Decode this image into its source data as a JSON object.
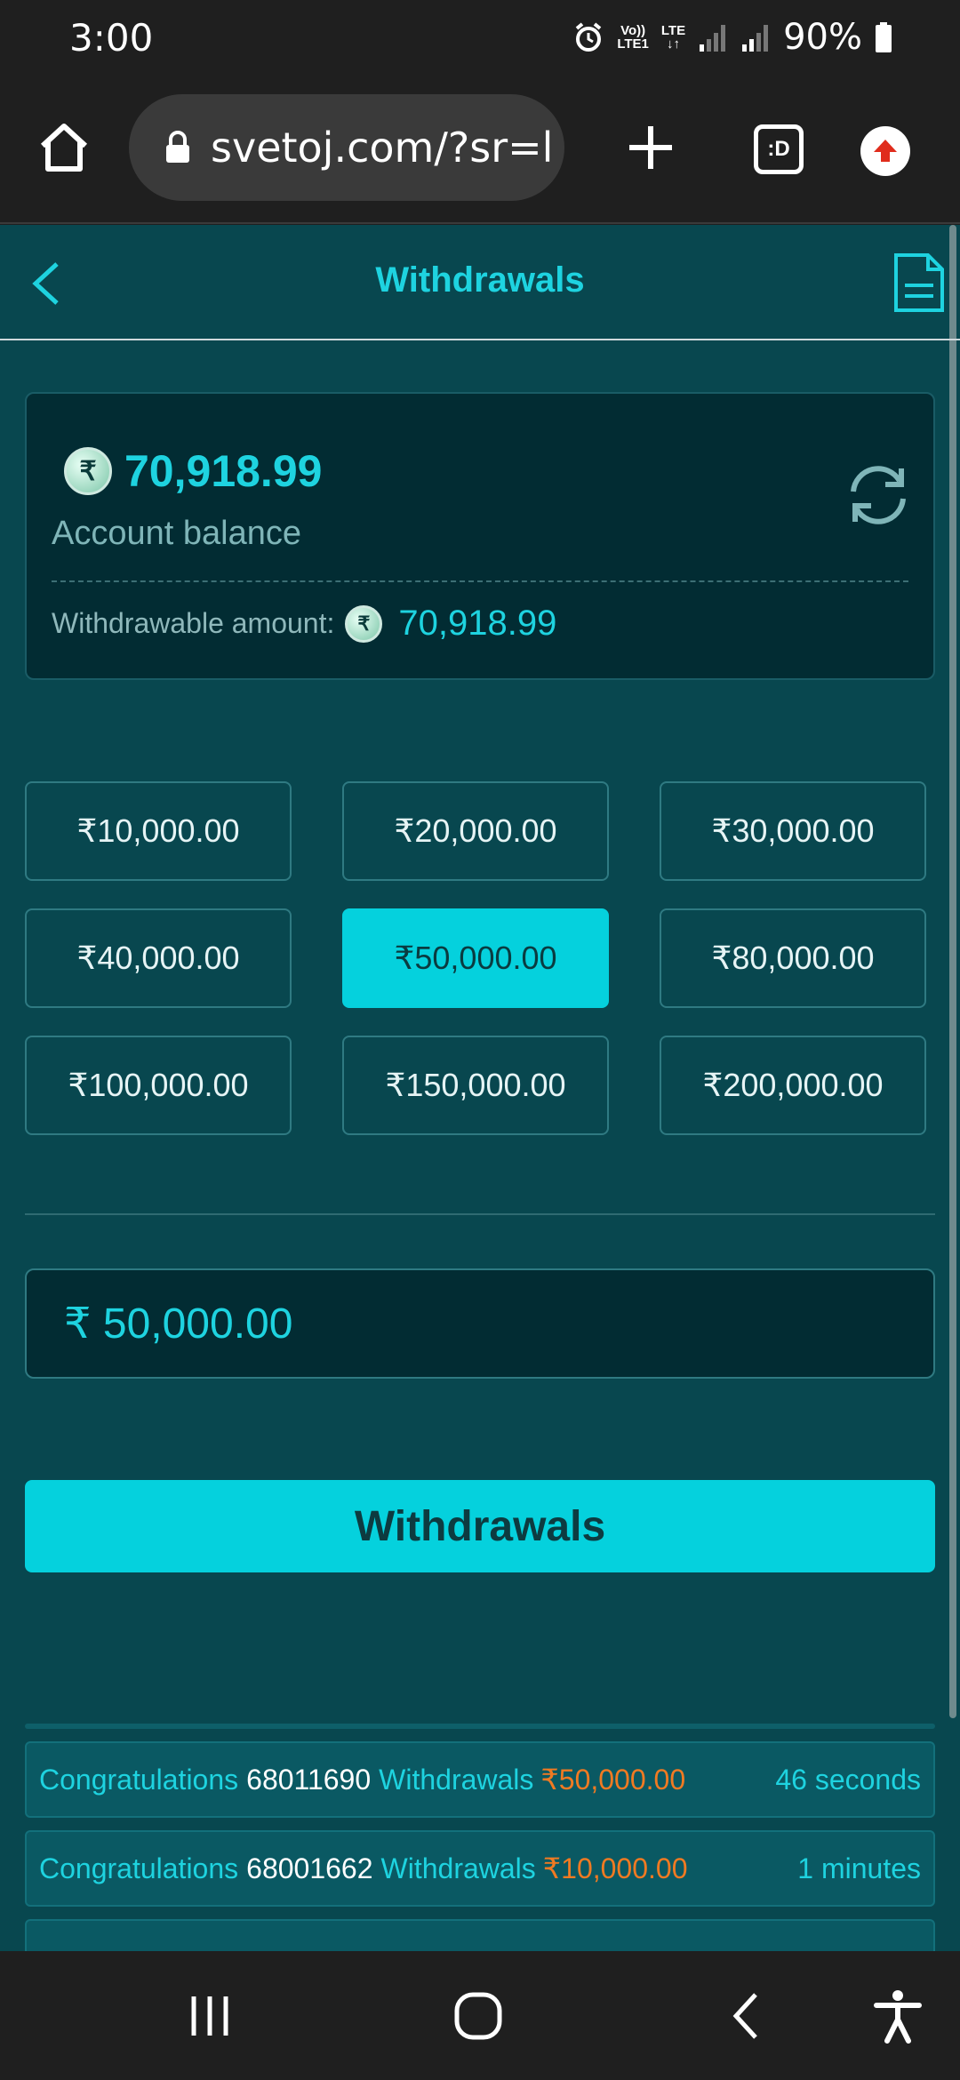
{
  "status_bar": {
    "time": "3:00",
    "battery": "90%",
    "net_top": "Vo))",
    "net_bottom": "LTE1",
    "lte": "LTE",
    "icons": [
      "alarm-icon",
      "signal-icon",
      "signal-icon",
      "battery-icon"
    ]
  },
  "browser": {
    "url": "svetoj.com/?sr=l",
    "tab_label": ":D",
    "icons": [
      "home-icon",
      "lock-icon",
      "plus-icon",
      "tabs-icon",
      "update-icon"
    ]
  },
  "header": {
    "title": "Withdrawals",
    "icons": [
      "back-icon",
      "document-icon"
    ]
  },
  "balance": {
    "coin_symbol": "₹",
    "value": "70,918.99",
    "label": "Account balance",
    "withdrawable_label": "Withdrawable amount:",
    "withdrawable_value": "70,918.99"
  },
  "amounts": [
    {
      "label": "₹10,000.00",
      "selected": false
    },
    {
      "label": "₹20,000.00",
      "selected": false
    },
    {
      "label": "₹30,000.00",
      "selected": false
    },
    {
      "label": "₹40,000.00",
      "selected": false
    },
    {
      "label": "₹50,000.00",
      "selected": true
    },
    {
      "label": "₹80,000.00",
      "selected": false
    },
    {
      "label": "₹100,000.00",
      "selected": false
    },
    {
      "label": "₹150,000.00",
      "selected": false
    },
    {
      "label": "₹200,000.00",
      "selected": false
    }
  ],
  "amount_input": {
    "value": "₹ 50,000.00"
  },
  "withdraw_button": {
    "label": "Withdrawals"
  },
  "feed": [
    {
      "congrats": "Congratulations",
      "id": "68011690",
      "action": "Withdrawals",
      "amount": "₹50,000.00",
      "time": "46 seconds"
    },
    {
      "congrats": "Congratulations",
      "id": "68001662",
      "action": "Withdrawals",
      "amount": "₹10,000.00",
      "time": "1 minutes"
    }
  ],
  "nav_bar": {
    "icons": [
      "recent-apps-icon",
      "home-circle-icon",
      "back-chevron-icon",
      "accessibility-icon"
    ]
  },
  "colors": {
    "accent": "#05d1dd",
    "page_bg": "#08474f",
    "card_bg": "#022c33",
    "amount_highlight": "#f07a22"
  }
}
